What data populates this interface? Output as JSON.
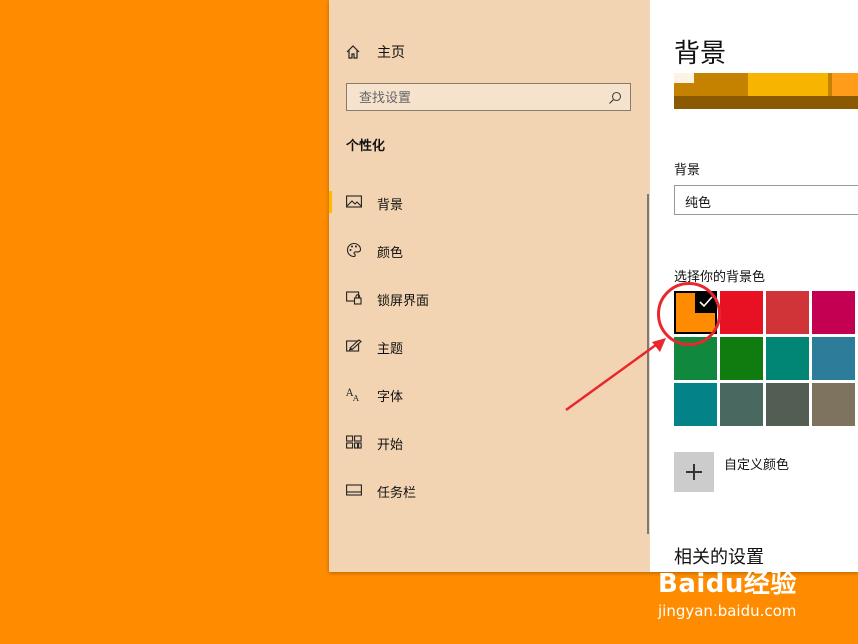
{
  "sidebar": {
    "home_label": "主页",
    "search_placeholder": "查找设置",
    "section_title": "个性化",
    "items": [
      {
        "label": "背景",
        "icon": "picture-icon",
        "active": true
      },
      {
        "label": "颜色",
        "icon": "palette-icon",
        "active": false
      },
      {
        "label": "锁屏界面",
        "icon": "lock-screen-icon",
        "active": false
      },
      {
        "label": "主题",
        "icon": "theme-icon",
        "active": false
      },
      {
        "label": "字体",
        "icon": "font-icon",
        "active": false
      },
      {
        "label": "开始",
        "icon": "start-icon",
        "active": false
      },
      {
        "label": "任务栏",
        "icon": "taskbar-icon",
        "active": false
      }
    ]
  },
  "content": {
    "page_title": "背景",
    "background_label": "背景",
    "background_value": "纯色",
    "choose_color_label": "选择你的背景色",
    "colors": [
      "#ff8c00",
      "#e81123",
      "#d13438",
      "#c30052",
      "#10893e",
      "#107c10",
      "#018574",
      "#2d7d9a",
      "#038387",
      "#486860",
      "#525e54",
      "#7e735f"
    ],
    "selected_color_index": 0,
    "custom_color_label": "自定义颜色",
    "related_settings": "相关的设置"
  },
  "watermark": {
    "brand": "Baidu经验",
    "url": "jingyan.baidu.com"
  },
  "colors": {
    "desktop": "#ff8c00",
    "sidebar_bg": "#f2d4b3",
    "accent": "#ffb900",
    "annotation": "#e8282e"
  }
}
